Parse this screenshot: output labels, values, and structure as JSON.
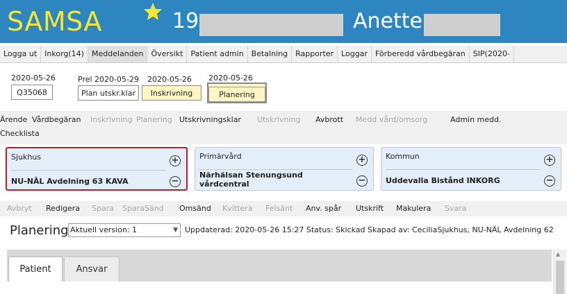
{
  "header": {
    "app_title": "SAMSA",
    "star_icon": "star-icon",
    "patient_number": "19",
    "patient_name": "Anette",
    "colors": {
      "background": "#2e86c1",
      "title": "#f4e637",
      "star": "#f4e637"
    }
  },
  "menu": [
    "Logga ut",
    "Inkorg(14)",
    "Meddelanden",
    "Översikt",
    "Patient admin",
    "Betalning",
    "Rapporter",
    "Loggar",
    "Förberedd vårdbegäran",
    "SIP(2020-"
  ],
  "status_row": {
    "case_date": "2020-05-26",
    "case_id": "Q35068",
    "prel_label": "Prel 2020-05-29",
    "plan_label": "Plan utskr.klar",
    "inskr_date": "2020-05-26",
    "inskr_label": "Inskrivning",
    "planering_date": "2020-05-26",
    "planering_label": "Planering"
  },
  "menu2": {
    "row1": [
      {
        "label": "Ärende",
        "enabled": true
      },
      {
        "label": "Vårdbegäran",
        "enabled": true
      },
      {
        "label": "Inskrivning",
        "enabled": false
      },
      {
        "label": "Planering",
        "enabled": false
      },
      {
        "label": "Utskrivningsklar",
        "enabled": true
      },
      {
        "label": "Utskrivning",
        "enabled": false
      },
      {
        "label": "Avbrott",
        "enabled": true
      },
      {
        "label": "Medd vård/omsorg",
        "enabled": false
      },
      {
        "label": "Admin medd.",
        "enabled": true
      }
    ],
    "row2": [
      {
        "label": "Checklista",
        "enabled": true
      }
    ]
  },
  "cards": [
    {
      "title": "Sjukhus",
      "name": "NU-NÄL Avdelning 63 KAVA",
      "highlighted": true
    },
    {
      "title": "Primärvård",
      "name_line1": "Närhälsan Stenungsund",
      "name_line2": "vårdcentral"
    },
    {
      "title": "Kommun",
      "name": "Uddevalla Bistånd INKORG"
    }
  ],
  "toolbar3": [
    {
      "label": "Avbryt",
      "enabled": false
    },
    {
      "label": "Redigera",
      "enabled": true
    },
    {
      "label": "Spara",
      "enabled": false
    },
    {
      "label": "SparaSänd",
      "enabled": false
    },
    {
      "label": "Omsänd",
      "enabled": true
    },
    {
      "label": "Kvittera",
      "enabled": false
    },
    {
      "label": "Felsänt",
      "enabled": false
    },
    {
      "label": "Anv. spår",
      "enabled": true
    },
    {
      "label": "Utskrift",
      "enabled": true
    },
    {
      "label": "Makulera",
      "enabled": true
    },
    {
      "label": "Svara",
      "enabled": false
    }
  ],
  "planering": {
    "title": "Planering",
    "version_selected": "Aktuell version: 1",
    "info": "Uppdaterad: 2020-05-26 15:27 Status: Skickad Skapad av: CeciliaSjukhus, NU-NÄL Avdelning 62"
  },
  "tabs": [
    "Patient",
    "Ansvar"
  ],
  "icons": {
    "plus": "plus-circle-icon",
    "minus": "minus-circle-icon",
    "dropdown": "chevron-down-icon",
    "scroll_up": "scroll-up-icon"
  }
}
